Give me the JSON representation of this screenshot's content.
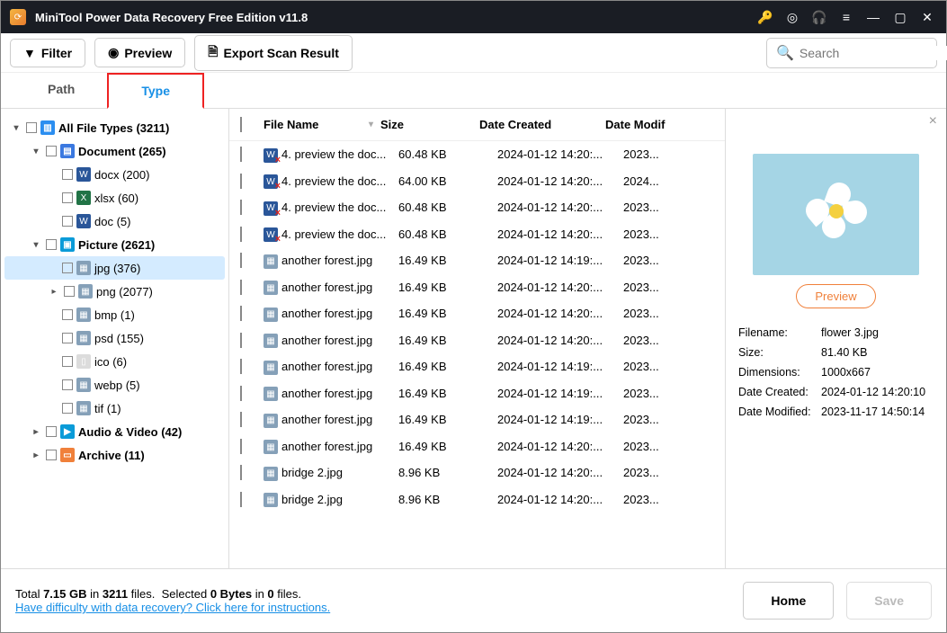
{
  "title": "MiniTool Power Data Recovery Free Edition v11.8",
  "toolbar": {
    "filter": "Filter",
    "preview": "Preview",
    "export": "Export Scan Result",
    "search_placeholder": "Search"
  },
  "tabs": {
    "path": "Path",
    "type": "Type"
  },
  "tree": {
    "all": "All File Types (3211)",
    "document": "Document (265)",
    "docx": "docx (200)",
    "xlsx": "xlsx (60)",
    "doc": "doc (5)",
    "picture": "Picture (2621)",
    "jpg": "jpg (376)",
    "png": "png (2077)",
    "bmp": "bmp (1)",
    "psd": "psd (155)",
    "ico": "ico (6)",
    "webp": "webp (5)",
    "tif": "tif (1)",
    "audio": "Audio & Video (42)",
    "archive": "Archive (11)"
  },
  "cols": {
    "name": "File Name",
    "size": "Size",
    "date": "Date Created",
    "mod": "Date Modif"
  },
  "rows": [
    {
      "name": "4. preview the doc...",
      "size": "60.48 KB",
      "date": "2024-01-12 14:20:...",
      "mod": "2023...",
      "del": true,
      "icon": "w"
    },
    {
      "name": "4. preview the doc...",
      "size": "64.00 KB",
      "date": "2024-01-12 14:20:...",
      "mod": "2024...",
      "del": true,
      "icon": "w"
    },
    {
      "name": "4. preview the doc...",
      "size": "60.48 KB",
      "date": "2024-01-12 14:20:...",
      "mod": "2023...",
      "del": true,
      "icon": "w"
    },
    {
      "name": "4. preview the doc...",
      "size": "60.48 KB",
      "date": "2024-01-12 14:20:...",
      "mod": "2023...",
      "del": true,
      "icon": "w"
    },
    {
      "name": "another forest.jpg",
      "size": "16.49 KB",
      "date": "2024-01-12 14:19:...",
      "mod": "2023...",
      "del": false,
      "icon": "i"
    },
    {
      "name": "another forest.jpg",
      "size": "16.49 KB",
      "date": "2024-01-12 14:20:...",
      "mod": "2023...",
      "del": false,
      "icon": "i"
    },
    {
      "name": "another forest.jpg",
      "size": "16.49 KB",
      "date": "2024-01-12 14:20:...",
      "mod": "2023...",
      "del": false,
      "icon": "i"
    },
    {
      "name": "another forest.jpg",
      "size": "16.49 KB",
      "date": "2024-01-12 14:20:...",
      "mod": "2023...",
      "del": false,
      "icon": "i"
    },
    {
      "name": "another forest.jpg",
      "size": "16.49 KB",
      "date": "2024-01-12 14:19:...",
      "mod": "2023...",
      "del": false,
      "icon": "i"
    },
    {
      "name": "another forest.jpg",
      "size": "16.49 KB",
      "date": "2024-01-12 14:19:...",
      "mod": "2023...",
      "del": false,
      "icon": "i"
    },
    {
      "name": "another forest.jpg",
      "size": "16.49 KB",
      "date": "2024-01-12 14:19:...",
      "mod": "2023...",
      "del": false,
      "icon": "i"
    },
    {
      "name": "another forest.jpg",
      "size": "16.49 KB",
      "date": "2024-01-12 14:20:...",
      "mod": "2023...",
      "del": false,
      "icon": "i"
    },
    {
      "name": "bridge 2.jpg",
      "size": "8.96 KB",
      "date": "2024-01-12 14:20:...",
      "mod": "2023...",
      "del": false,
      "icon": "i"
    },
    {
      "name": "bridge 2.jpg",
      "size": "8.96 KB",
      "date": "2024-01-12 14:20:...",
      "mod": "2023...",
      "del": false,
      "icon": "i"
    }
  ],
  "preview": {
    "btn": "Preview",
    "labels": {
      "filename": "Filename:",
      "size": "Size:",
      "dim": "Dimensions:",
      "created": "Date Created:",
      "modified": "Date Modified:"
    },
    "filename": "flower 3.jpg",
    "size": "81.40 KB",
    "dim": "1000x667",
    "created": "2024-01-12 14:20:10",
    "modified": "2023-11-17 14:50:14"
  },
  "footer": {
    "total_pre": "Total ",
    "total_size": "7.15 GB",
    "total_mid": " in ",
    "total_files": "3211",
    "total_post": " files.",
    "sel_pre": "Selected ",
    "sel_bytes": "0 Bytes",
    "sel_mid": " in ",
    "sel_count": "0",
    "sel_post": " files.",
    "help_link": "Have difficulty with data recovery? Click here for instructions.",
    "home": "Home",
    "save": "Save"
  }
}
